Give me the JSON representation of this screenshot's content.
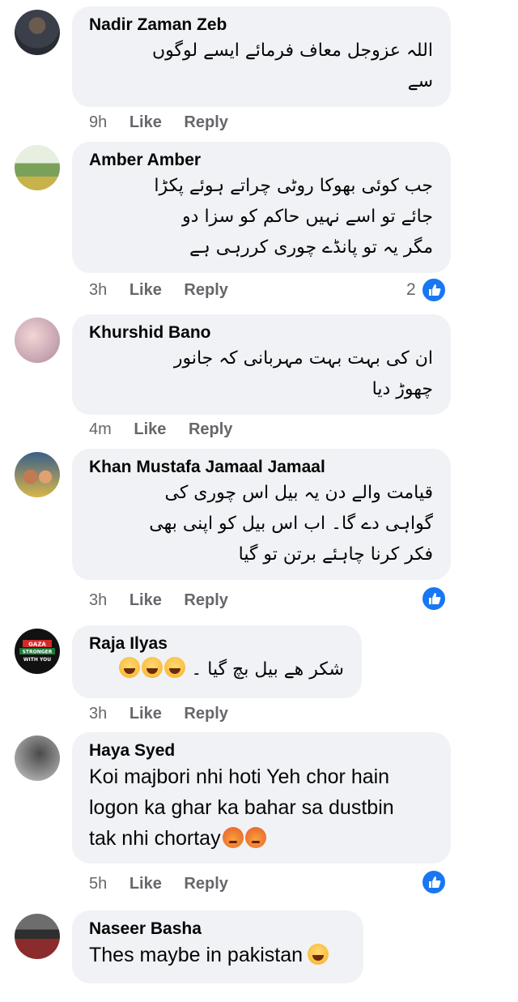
{
  "actions": {
    "like_label": "Like",
    "reply_label": "Reply"
  },
  "comments": [
    {
      "author": "Nadir Zaman Zeb",
      "lines": [
        "اللہ عزوجل معاف فرمائے ایسے لوگوں",
        "سے"
      ],
      "time": "9h"
    },
    {
      "author": "Amber Amber",
      "lines": [
        "جب کوئی بھوکا روٹی چراتے ہوئے پکڑا",
        "جائے تو اسے نہیں حاکم کو سزا دو",
        "مگر یہ تو پانڈے چوری کررہی ہے"
      ],
      "time": "3h",
      "reactions": "2"
    },
    {
      "author": "Khurshid Bano",
      "lines": [
        "ان کی بہت بہت مہربانی کہ جانور",
        "چھوڑ دیا"
      ],
      "time": "4m"
    },
    {
      "author": "Khan Mustafa Jamaal Jamaal",
      "lines": [
        "قیامت والے دن یہ بیل اس چوری کی",
        "گواہی دے گا۔ اب اس بیل کو اپنی بھی",
        "فکر کرنا چاہئے برتن تو گیا"
      ],
      "time": "3h"
    },
    {
      "author": "Raja Ilyas",
      "lines": [
        "شکر ھے بیل بچ گیا ۔"
      ],
      "time": "3h",
      "avatar_text": "GAZA STRONGER WITH YOU"
    },
    {
      "author": "Haya Syed",
      "lines": [
        "Koi majbori nhi hoti Yeh chor hain",
        "logon ka ghar ka bahar sa dustbin",
        "tak nhi chortay"
      ],
      "time": "5h"
    },
    {
      "author": "Naseer Basha",
      "lines": [
        "Thes maybe in pakistan"
      ]
    }
  ],
  "colors": {
    "like_blue": "#1877f2",
    "bubble_bg": "#f0f2f5",
    "meta_gray": "#65676b"
  }
}
